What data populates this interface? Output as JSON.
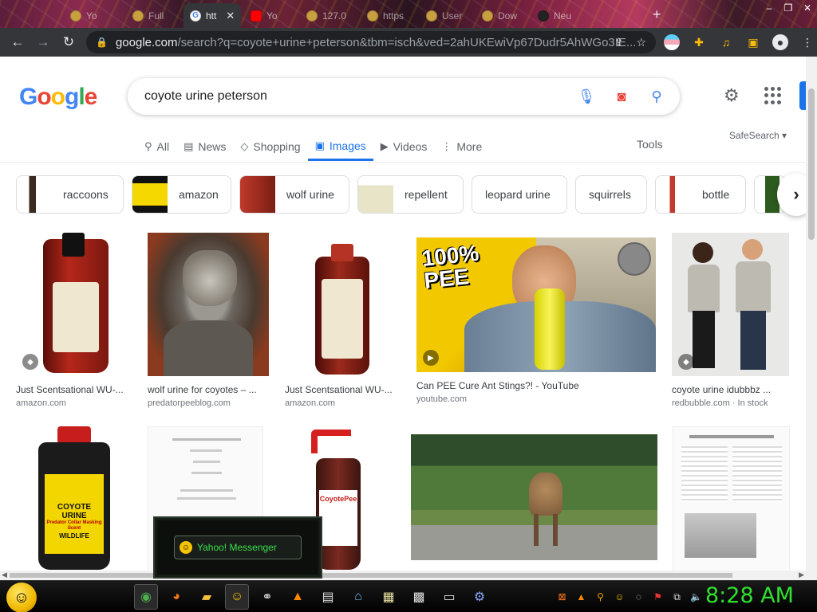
{
  "browser": {
    "tabs": [
      {
        "label": "Yo"
      },
      {
        "label": "Full"
      },
      {
        "label": "htt",
        "active": true
      },
      {
        "label": "Yo"
      },
      {
        "label": "127.0"
      },
      {
        "label": "https"
      },
      {
        "label": "User"
      },
      {
        "label": "Dow"
      },
      {
        "label": "Neu"
      }
    ],
    "new_tab_glyph": "+",
    "url_host": "google.com",
    "url_rest": "/search?q=coyote+urine+peterson&tbm=isch&ved=2ahUKEwiVp67Dudr5AhWGo3IE..."
  },
  "google": {
    "query": "coyote urine peterson",
    "nav_tabs": [
      {
        "label": "All",
        "icon": "search-icon"
      },
      {
        "label": "News",
        "icon": "news-icon"
      },
      {
        "label": "Shopping",
        "icon": "tag-icon"
      },
      {
        "label": "Images",
        "icon": "image-icon",
        "active": true
      },
      {
        "label": "Videos",
        "icon": "play-icon"
      },
      {
        "label": "More",
        "icon": "more-vertical-icon"
      }
    ],
    "tools_label": "Tools",
    "safesearch_label": "SafeSearch",
    "chips": [
      {
        "label": "raccoons"
      },
      {
        "label": "amazon"
      },
      {
        "label": "wolf urine"
      },
      {
        "label": "repellent"
      },
      {
        "label": "leopard urine"
      },
      {
        "label": "squirrels"
      },
      {
        "label": "bottle"
      }
    ],
    "results_row1": [
      {
        "title": "Just Scentsational WU-...",
        "source": "amazon.com"
      },
      {
        "title": "wolf urine for coyotes – ...",
        "source": "predatorpeeblog.com"
      },
      {
        "title": "Just Scentsational WU-...",
        "source": "amazon.com"
      },
      {
        "title": "Can PEE Cure Ant Stings?! - YouTube",
        "source": "youtube.com"
      },
      {
        "title": "coyote urine idubbbz ...",
        "source": "redbubble.com · In stock"
      }
    ],
    "image_text": {
      "pee_banner": "100% PEE",
      "coyote_bottle_brand": "COYOTE URINE",
      "coyote_bottle_sub": "Predator Collar Masking Scent",
      "coyote_bottle_maker": "WILDLIFE",
      "spray_brand": "CoyotePee"
    }
  },
  "messenger": {
    "label": "Yahoo! Messenger"
  },
  "taskbar": {
    "clock": "8:28 AM"
  },
  "colors": {
    "accent": "#1a73e8",
    "clock": "#30e030",
    "messenger_text": "#38e04a"
  }
}
